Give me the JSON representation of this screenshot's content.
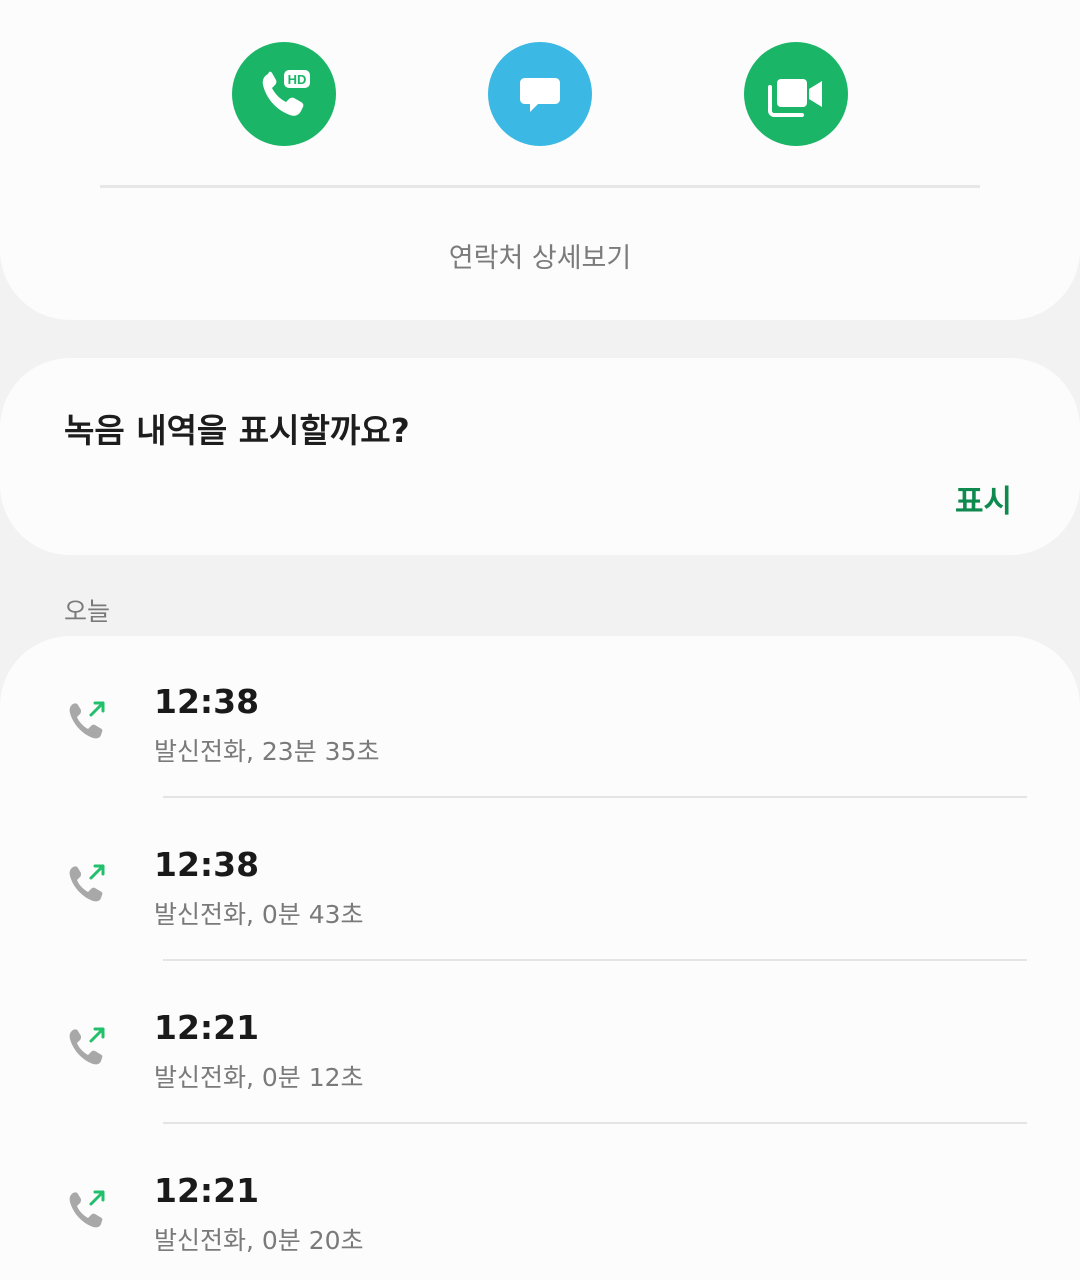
{
  "contact_actions": {
    "call_badge": "HD",
    "call_color": "#1ab567",
    "message_color": "#3bb8e3",
    "video_color": "#1ab567",
    "detail_label": "연락처 상세보기"
  },
  "recording": {
    "question": "녹음 내역을 표시할까요?",
    "show_label": "표시",
    "accent": "#0f8a4f"
  },
  "history": {
    "section_label": "오늘",
    "calls": [
      {
        "time": "12:38",
        "detail": "발신전화, 23분 35초",
        "icon": "outgoing-call-icon"
      },
      {
        "time": "12:38",
        "detail": "발신전화, 0분 43초",
        "icon": "outgoing-call-icon"
      },
      {
        "time": "12:21",
        "detail": "발신전화, 0분 12초",
        "icon": "outgoing-call-icon"
      },
      {
        "time": "12:21",
        "detail": "발신전화, 0분 20초",
        "icon": "outgoing-call-icon"
      }
    ]
  }
}
